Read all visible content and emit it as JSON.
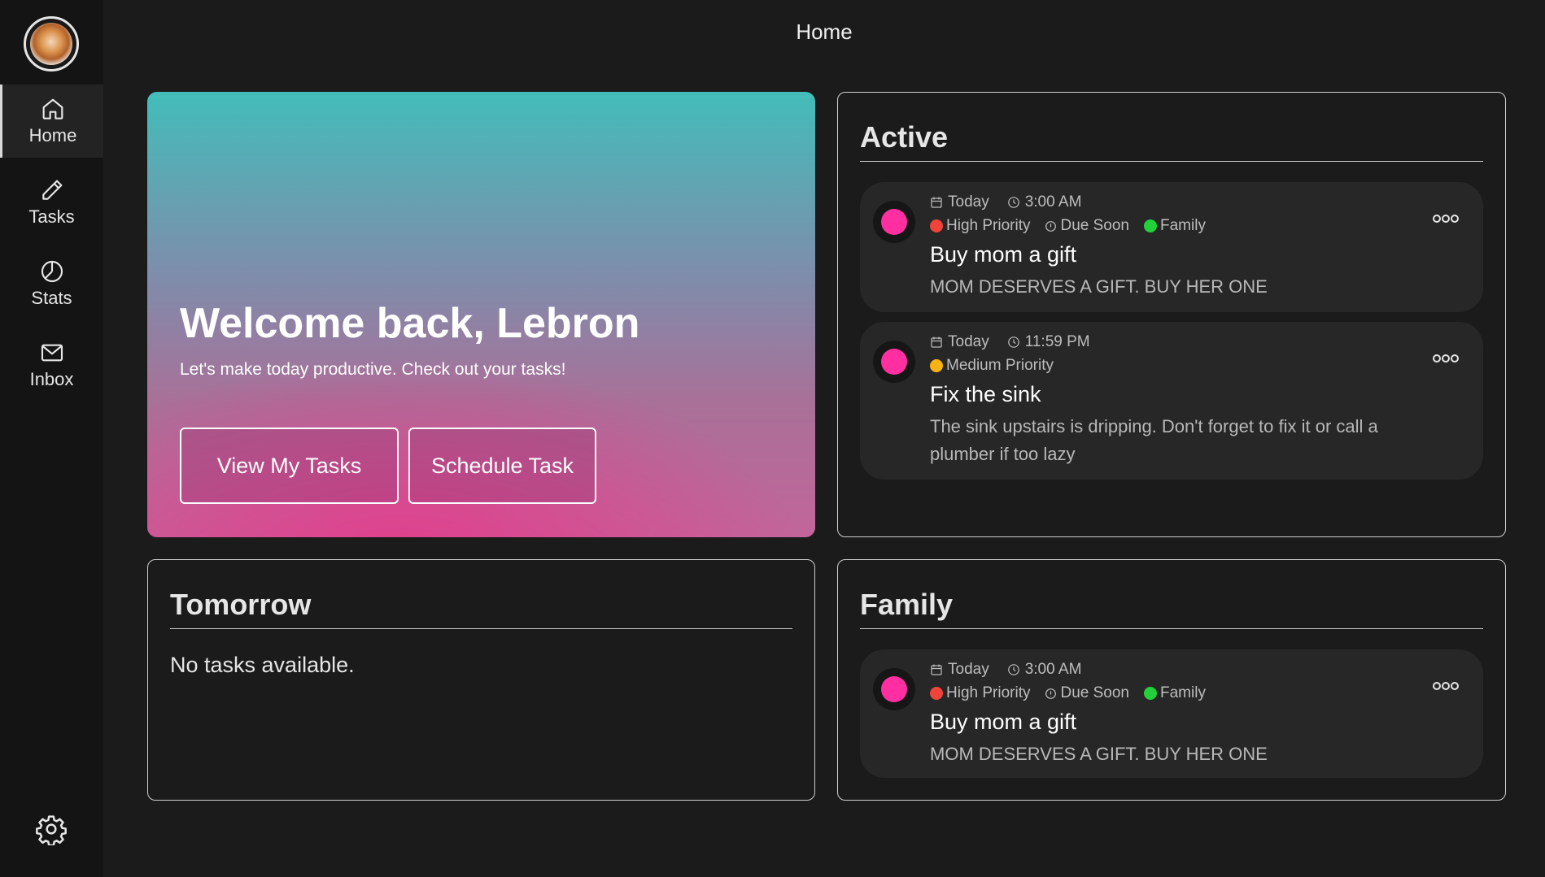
{
  "header": {
    "title": "Home"
  },
  "sidebar": {
    "items": [
      {
        "label": "Home",
        "icon": "home-icon",
        "active": true
      },
      {
        "label": "Tasks",
        "icon": "pencil-icon"
      },
      {
        "label": "Stats",
        "icon": "pie-chart-icon"
      },
      {
        "label": "Inbox",
        "icon": "mail-icon"
      }
    ],
    "settings_icon": "gear-icon"
  },
  "hero": {
    "title": "Welcome back, Lebron",
    "subtitle": "Let's make today productive. Check out your tasks!",
    "view_button": "View My Tasks",
    "schedule_button": "Schedule Task"
  },
  "active": {
    "title": "Active",
    "tasks": [
      {
        "date": "Today",
        "time": "3:00 AM",
        "priority": "High Priority",
        "due": "Due Soon",
        "category": "Family",
        "title": "Buy mom a gift",
        "description": "MOM DESERVES A GIFT. BUY HER ONE"
      },
      {
        "date": "Today",
        "time": "11:59 PM",
        "priority": "Medium Priority",
        "title": "Fix the sink",
        "description": "The sink upstairs is dripping. Don't forget to fix it or call a plumber if too lazy"
      }
    ]
  },
  "tomorrow": {
    "title": "Tomorrow",
    "empty_text": "No tasks available."
  },
  "family": {
    "title": "Family",
    "tasks": [
      {
        "date": "Today",
        "time": "3:00 AM",
        "priority": "High Priority",
        "due": "Due Soon",
        "category": "Family",
        "title": "Buy mom a gift",
        "description": "MOM DESERVES A GIFT. BUY HER ONE"
      }
    ]
  },
  "colors": {
    "high_priority": "#f0443a",
    "medium_priority": "#f6b313",
    "family_tag": "#22d13a",
    "task_dot": "#ff2fa1"
  }
}
